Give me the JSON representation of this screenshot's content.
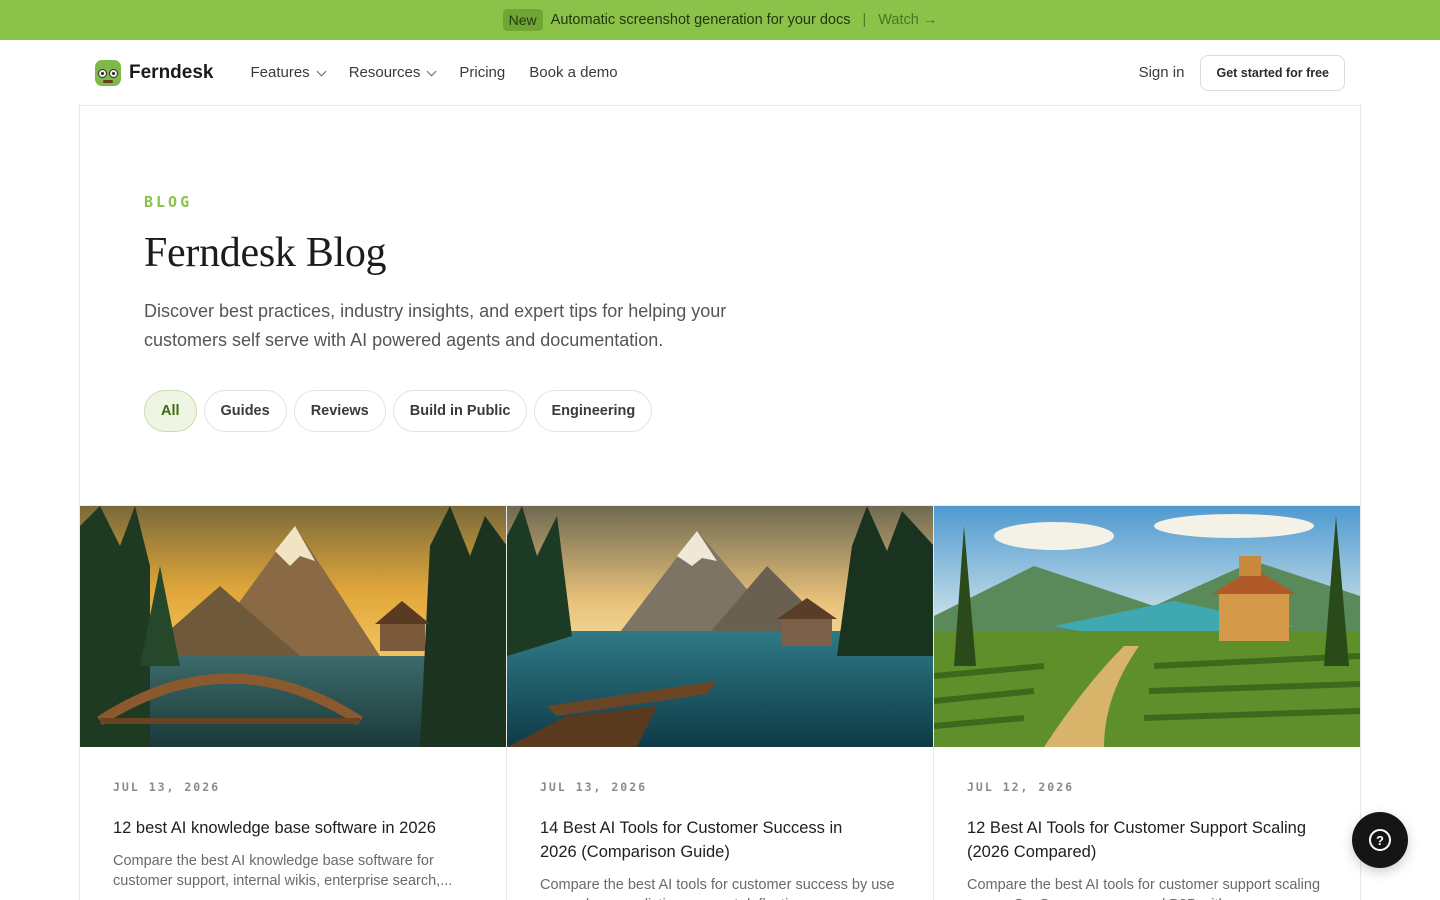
{
  "announcement": {
    "badge": "New",
    "message": "Automatic screenshot generation for your docs",
    "separator": "|",
    "link": "Watch →"
  },
  "nav": {
    "brand": "Ferndesk",
    "items": [
      {
        "label": "Features",
        "dropdown": true
      },
      {
        "label": "Resources",
        "dropdown": true
      },
      {
        "label": "Pricing",
        "dropdown": false
      },
      {
        "label": "Book a demo",
        "dropdown": false
      }
    ],
    "sign_in": "Sign in",
    "cta": "Get started for free"
  },
  "hero": {
    "eyebrow": "BLOG",
    "title": "Ferndesk Blog",
    "description": "Discover best practices, industry insights, and expert tips for helping your customers self serve with AI powered agents and documentation."
  },
  "filters": [
    {
      "label": "All",
      "active": true
    },
    {
      "label": "Guides",
      "active": false
    },
    {
      "label": "Reviews",
      "active": false
    },
    {
      "label": "Build in Public",
      "active": false
    },
    {
      "label": "Engineering",
      "active": false
    }
  ],
  "posts": [
    {
      "date": "JUL 13, 2026",
      "title": "12 best AI knowledge base software in 2026",
      "excerpt": "Compare the best AI knowledge base software for customer support, internal wikis, enterprise search,...",
      "image": "mountain-lake-bridge-cabin-illustration"
    },
    {
      "date": "JUL 13, 2026",
      "title": "14 Best AI Tools for Customer Success in 2026 (Comparison Guide)",
      "excerpt": "Compare the best AI tools for customer success by use case: churn prediction, support deflection,...",
      "image": "mountain-lake-rowboat-dock-illustration"
    },
    {
      "date": "JUL 12, 2026",
      "title": "12 Best AI Tools for Customer Support Scaling (2026 Compared)",
      "excerpt": "Compare the best AI tools for customer support scaling across SaaS, ecommerce, and B2B with...",
      "image": "vineyard-villa-lake-illustration"
    }
  ],
  "colors": {
    "accent_green": "#8bc34a",
    "active_chip_bg": "#eef5e3",
    "fab_bg": "#151515"
  },
  "help": {
    "icon": "question-circle-icon"
  }
}
